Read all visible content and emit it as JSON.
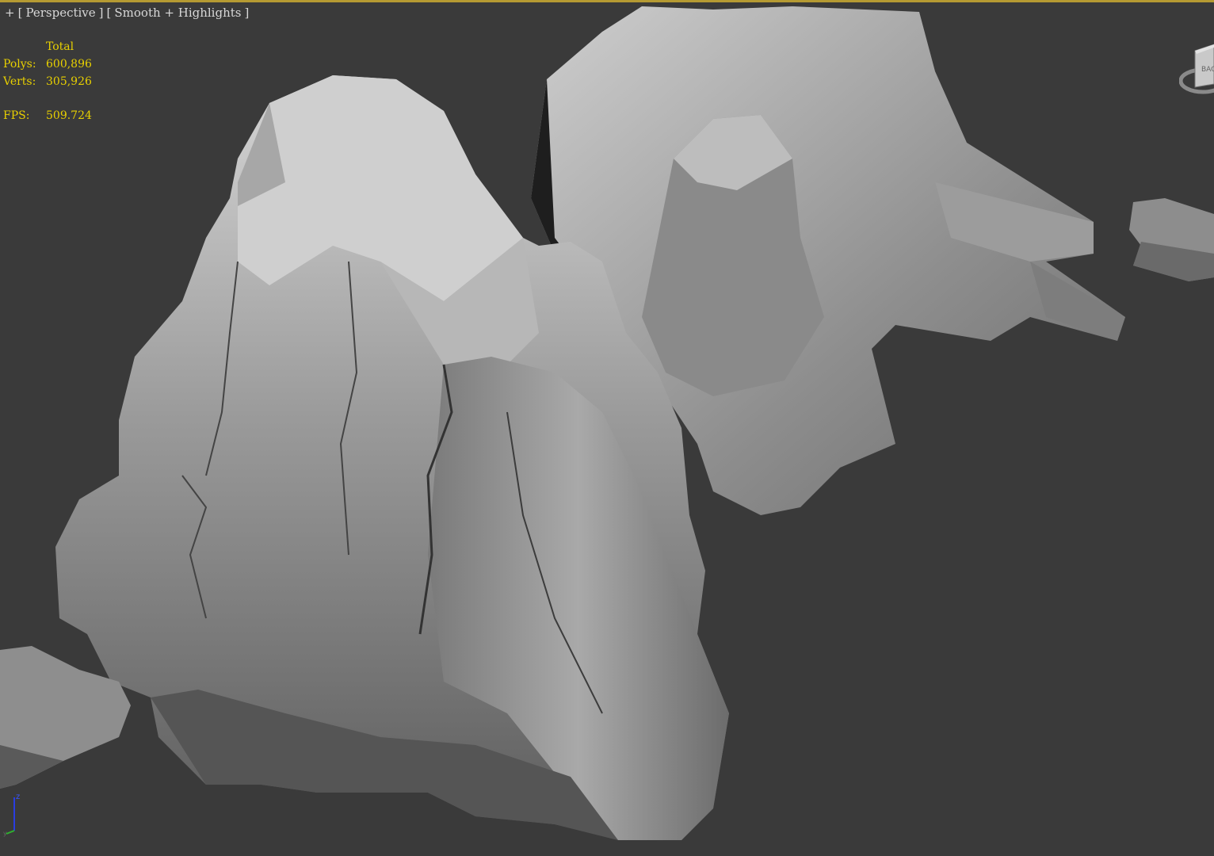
{
  "viewport": {
    "label_parts": [
      "+",
      "[",
      "Perspective",
      "]",
      "[",
      "Smooth + Highlights",
      "]"
    ],
    "background_color": "#3a3a3a",
    "active_border_color": "#b59a32"
  },
  "stats": {
    "header": "Total",
    "polys_label": "Polys:",
    "polys_value": "600,896",
    "verts_label": "Verts:",
    "verts_value": "305,926",
    "fps_label": "FPS:",
    "fps_value": "509.724",
    "text_color": "#e8d000"
  },
  "viewcube": {
    "face_label": "BAC"
  },
  "axis_tripod": {
    "z_label": "z",
    "y_label": "y"
  },
  "scene": {
    "object": "rock-cliff-model",
    "shading": "Smooth + Highlights"
  }
}
